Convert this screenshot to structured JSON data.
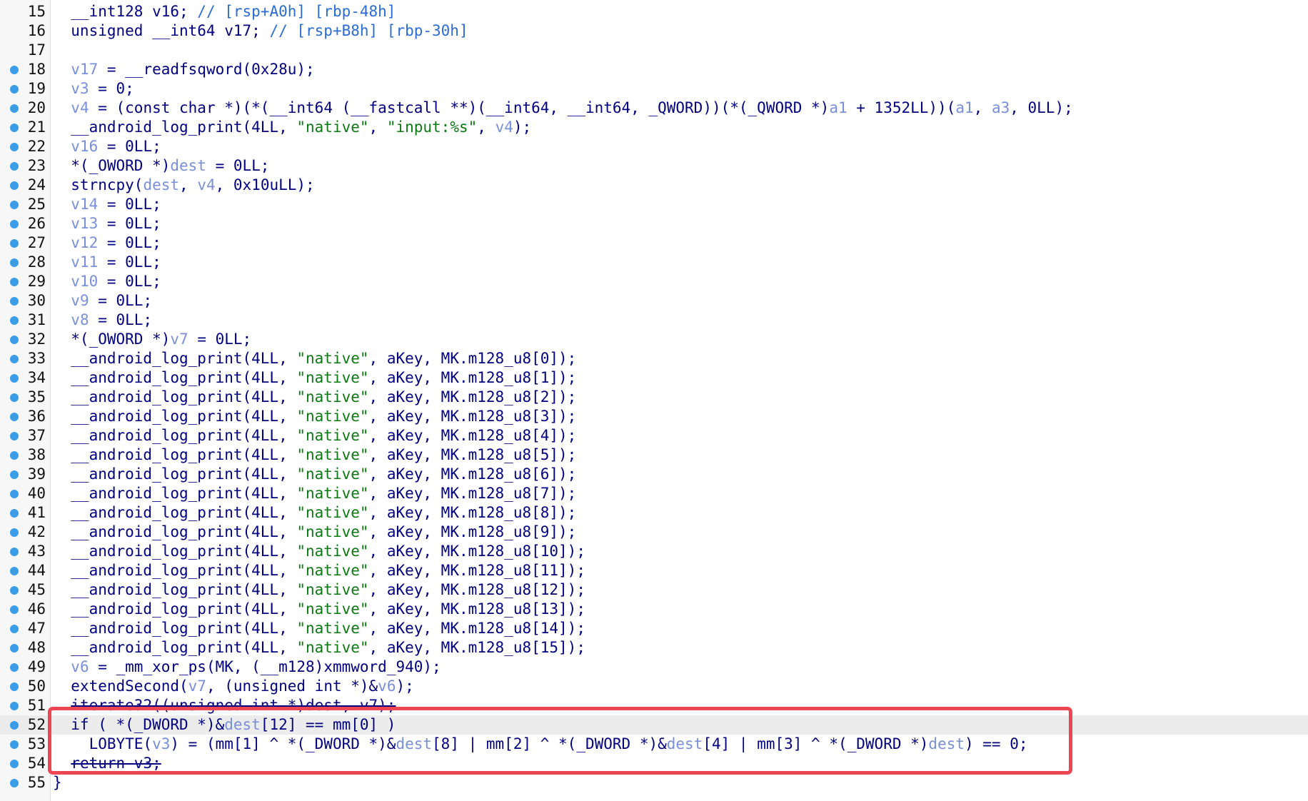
{
  "editor": {
    "lines": [
      {
        "n": "15",
        "bp": false,
        "tokens": [
          {
            "t": "  __int128 v16; "
          },
          {
            "t": "// [rsp+A0h] [rbp-48h]",
            "c": "c"
          }
        ]
      },
      {
        "n": "16",
        "bp": false,
        "tokens": [
          {
            "t": "  unsigned __int64 v17; "
          },
          {
            "t": "// [rsp+B8h] [rbp-30h]",
            "c": "c"
          }
        ]
      },
      {
        "n": "17",
        "bp": false,
        "tokens": []
      },
      {
        "n": "18",
        "bp": true,
        "tokens": [
          {
            "t": "  "
          },
          {
            "t": "v17",
            "c": "v"
          },
          {
            "t": " = __readfsqword(0x28u);"
          }
        ]
      },
      {
        "n": "19",
        "bp": true,
        "tokens": [
          {
            "t": "  "
          },
          {
            "t": "v3",
            "c": "v"
          },
          {
            "t": " = 0;"
          }
        ]
      },
      {
        "n": "20",
        "bp": true,
        "tokens": [
          {
            "t": "  "
          },
          {
            "t": "v4",
            "c": "v"
          },
          {
            "t": " = (const char *)(*(__int64 (__fastcall **)(__int64, __int64, _QWORD))(*(_QWORD *)"
          },
          {
            "t": "a1",
            "c": "v"
          },
          {
            "t": " + 1352LL))("
          },
          {
            "t": "a1",
            "c": "v"
          },
          {
            "t": ", "
          },
          {
            "t": "a3",
            "c": "v"
          },
          {
            "t": ", 0LL);"
          }
        ]
      },
      {
        "n": "21",
        "bp": true,
        "tokens": [
          {
            "t": "  __android_log_print(4LL, "
          },
          {
            "t": "\"native\"",
            "c": "s"
          },
          {
            "t": ", "
          },
          {
            "t": "\"input:%s\"",
            "c": "s"
          },
          {
            "t": ", "
          },
          {
            "t": "v4",
            "c": "v"
          },
          {
            "t": ");"
          }
        ]
      },
      {
        "n": "22",
        "bp": true,
        "tokens": [
          {
            "t": "  "
          },
          {
            "t": "v16",
            "c": "v"
          },
          {
            "t": " = 0LL;"
          }
        ]
      },
      {
        "n": "23",
        "bp": true,
        "tokens": [
          {
            "t": "  *(_OWORD *)"
          },
          {
            "t": "dest",
            "c": "v"
          },
          {
            "t": " = 0LL;"
          }
        ]
      },
      {
        "n": "24",
        "bp": true,
        "tokens": [
          {
            "t": "  strncpy("
          },
          {
            "t": "dest",
            "c": "v"
          },
          {
            "t": ", "
          },
          {
            "t": "v4",
            "c": "v"
          },
          {
            "t": ", 0x10uLL);"
          }
        ]
      },
      {
        "n": "25",
        "bp": true,
        "tokens": [
          {
            "t": "  "
          },
          {
            "t": "v14",
            "c": "v"
          },
          {
            "t": " = 0LL;"
          }
        ]
      },
      {
        "n": "26",
        "bp": true,
        "tokens": [
          {
            "t": "  "
          },
          {
            "t": "v13",
            "c": "v"
          },
          {
            "t": " = 0LL;"
          }
        ]
      },
      {
        "n": "27",
        "bp": true,
        "tokens": [
          {
            "t": "  "
          },
          {
            "t": "v12",
            "c": "v"
          },
          {
            "t": " = 0LL;"
          }
        ]
      },
      {
        "n": "28",
        "bp": true,
        "tokens": [
          {
            "t": "  "
          },
          {
            "t": "v11",
            "c": "v"
          },
          {
            "t": " = 0LL;"
          }
        ]
      },
      {
        "n": "29",
        "bp": true,
        "tokens": [
          {
            "t": "  "
          },
          {
            "t": "v10",
            "c": "v"
          },
          {
            "t": " = 0LL;"
          }
        ]
      },
      {
        "n": "30",
        "bp": true,
        "tokens": [
          {
            "t": "  "
          },
          {
            "t": "v9",
            "c": "v"
          },
          {
            "t": " = 0LL;"
          }
        ]
      },
      {
        "n": "31",
        "bp": true,
        "tokens": [
          {
            "t": "  "
          },
          {
            "t": "v8",
            "c": "v"
          },
          {
            "t": " = 0LL;"
          }
        ]
      },
      {
        "n": "32",
        "bp": true,
        "tokens": [
          {
            "t": "  *(_OWORD *)"
          },
          {
            "t": "v7",
            "c": "v"
          },
          {
            "t": " = 0LL;"
          }
        ]
      },
      {
        "n": "33",
        "bp": true,
        "tokens": [
          {
            "t": "  __android_log_print(4LL, "
          },
          {
            "t": "\"native\"",
            "c": "s"
          },
          {
            "t": ", aKey, MK.m128_u8[0]);"
          }
        ]
      },
      {
        "n": "34",
        "bp": true,
        "tokens": [
          {
            "t": "  __android_log_print(4LL, "
          },
          {
            "t": "\"native\"",
            "c": "s"
          },
          {
            "t": ", aKey, MK.m128_u8[1]);"
          }
        ]
      },
      {
        "n": "35",
        "bp": true,
        "tokens": [
          {
            "t": "  __android_log_print(4LL, "
          },
          {
            "t": "\"native\"",
            "c": "s"
          },
          {
            "t": ", aKey, MK.m128_u8[2]);"
          }
        ]
      },
      {
        "n": "36",
        "bp": true,
        "tokens": [
          {
            "t": "  __android_log_print(4LL, "
          },
          {
            "t": "\"native\"",
            "c": "s"
          },
          {
            "t": ", aKey, MK.m128_u8[3]);"
          }
        ]
      },
      {
        "n": "37",
        "bp": true,
        "tokens": [
          {
            "t": "  __android_log_print(4LL, "
          },
          {
            "t": "\"native\"",
            "c": "s"
          },
          {
            "t": ", aKey, MK.m128_u8[4]);"
          }
        ]
      },
      {
        "n": "38",
        "bp": true,
        "tokens": [
          {
            "t": "  __android_log_print(4LL, "
          },
          {
            "t": "\"native\"",
            "c": "s"
          },
          {
            "t": ", aKey, MK.m128_u8[5]);"
          }
        ]
      },
      {
        "n": "39",
        "bp": true,
        "tokens": [
          {
            "t": "  __android_log_print(4LL, "
          },
          {
            "t": "\"native\"",
            "c": "s"
          },
          {
            "t": ", aKey, MK.m128_u8[6]);"
          }
        ]
      },
      {
        "n": "40",
        "bp": true,
        "tokens": [
          {
            "t": "  __android_log_print(4LL, "
          },
          {
            "t": "\"native\"",
            "c": "s"
          },
          {
            "t": ", aKey, MK.m128_u8[7]);"
          }
        ]
      },
      {
        "n": "41",
        "bp": true,
        "tokens": [
          {
            "t": "  __android_log_print(4LL, "
          },
          {
            "t": "\"native\"",
            "c": "s"
          },
          {
            "t": ", aKey, MK.m128_u8[8]);"
          }
        ]
      },
      {
        "n": "42",
        "bp": true,
        "tokens": [
          {
            "t": "  __android_log_print(4LL, "
          },
          {
            "t": "\"native\"",
            "c": "s"
          },
          {
            "t": ", aKey, MK.m128_u8[9]);"
          }
        ]
      },
      {
        "n": "43",
        "bp": true,
        "tokens": [
          {
            "t": "  __android_log_print(4LL, "
          },
          {
            "t": "\"native\"",
            "c": "s"
          },
          {
            "t": ", aKey, MK.m128_u8[10]);"
          }
        ]
      },
      {
        "n": "44",
        "bp": true,
        "tokens": [
          {
            "t": "  __android_log_print(4LL, "
          },
          {
            "t": "\"native\"",
            "c": "s"
          },
          {
            "t": ", aKey, MK.m128_u8[11]);"
          }
        ]
      },
      {
        "n": "45",
        "bp": true,
        "tokens": [
          {
            "t": "  __android_log_print(4LL, "
          },
          {
            "t": "\"native\"",
            "c": "s"
          },
          {
            "t": ", aKey, MK.m128_u8[12]);"
          }
        ]
      },
      {
        "n": "46",
        "bp": true,
        "tokens": [
          {
            "t": "  __android_log_print(4LL, "
          },
          {
            "t": "\"native\"",
            "c": "s"
          },
          {
            "t": ", aKey, MK.m128_u8[13]);"
          }
        ]
      },
      {
        "n": "47",
        "bp": true,
        "tokens": [
          {
            "t": "  __android_log_print(4LL, "
          },
          {
            "t": "\"native\"",
            "c": "s"
          },
          {
            "t": ", aKey, MK.m128_u8[14]);"
          }
        ]
      },
      {
        "n": "48",
        "bp": true,
        "tokens": [
          {
            "t": "  __android_log_print(4LL, "
          },
          {
            "t": "\"native\"",
            "c": "s"
          },
          {
            "t": ", aKey, MK.m128_u8[15]);"
          }
        ]
      },
      {
        "n": "49",
        "bp": true,
        "tokens": [
          {
            "t": "  "
          },
          {
            "t": "v6",
            "c": "v"
          },
          {
            "t": " = _mm_xor_ps(MK, (__m128)xmmword_940);"
          }
        ]
      },
      {
        "n": "50",
        "bp": true,
        "tokens": [
          {
            "t": "  extendSecond("
          },
          {
            "t": "v7",
            "c": "v"
          },
          {
            "t": ", (unsigned int *)&"
          },
          {
            "t": "v6",
            "c": "v"
          },
          {
            "t": ");"
          }
        ]
      },
      {
        "n": "51",
        "bp": true,
        "tokens": [
          {
            "t": "  "
          },
          {
            "t": "iterate32((unsigned int *)dest, v7);",
            "c": "strike"
          }
        ]
      },
      {
        "n": "52",
        "bp": true,
        "hl": true,
        "tokens": [
          {
            "t": "  if ( *(_DWORD *)&"
          },
          {
            "t": "dest",
            "c": "v"
          },
          {
            "t": "[12] == mm[0] )"
          }
        ]
      },
      {
        "n": "53",
        "bp": true,
        "tokens": [
          {
            "t": "    LOBYTE("
          },
          {
            "t": "v3",
            "c": "v"
          },
          {
            "t": ") = (mm[1] ^ *(_DWORD *)&"
          },
          {
            "t": "dest",
            "c": "v"
          },
          {
            "t": "[8] | mm[2] ^ *(_DWORD *)&"
          },
          {
            "t": "dest",
            "c": "v"
          },
          {
            "t": "[4] | mm[3] ^ *(_DWORD *)"
          },
          {
            "t": "dest",
            "c": "v"
          },
          {
            "t": ") == 0;"
          }
        ]
      },
      {
        "n": "54",
        "bp": true,
        "tokens": [
          {
            "t": "  "
          },
          {
            "t": "return v3;",
            "c": "strike"
          }
        ]
      },
      {
        "n": "55",
        "bp": true,
        "tokens": [
          {
            "t": "}"
          }
        ]
      }
    ]
  }
}
